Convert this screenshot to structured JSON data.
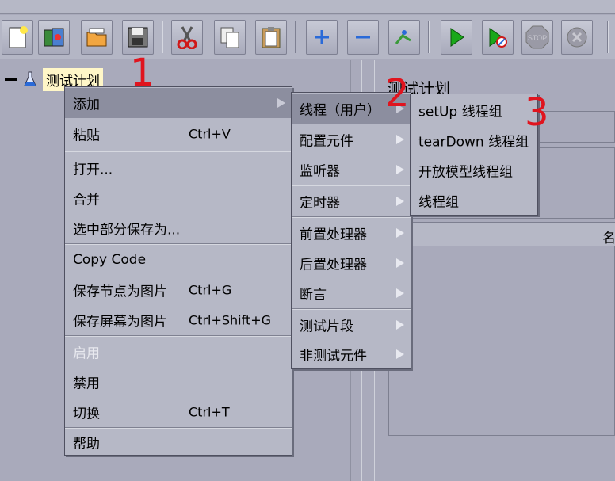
{
  "tree": {
    "root_label": "测试计划"
  },
  "right_pane": {
    "title": "测试计划",
    "column_header": "名"
  },
  "context_menu": {
    "items": [
      {
        "label": "添加",
        "shortcut": "",
        "submenu": true,
        "highlighted": true
      },
      {
        "label": "粘贴",
        "shortcut": "Ctrl+V"
      },
      {
        "label": "打开...",
        "shortcut": ""
      },
      {
        "label": "合并",
        "shortcut": ""
      },
      {
        "label": "选中部分保存为...",
        "shortcut": ""
      },
      {
        "label": "Copy Code",
        "shortcut": ""
      },
      {
        "label": "保存节点为图片",
        "shortcut": "Ctrl+G"
      },
      {
        "label": "保存屏幕为图片",
        "shortcut": "Ctrl+Shift+G"
      },
      {
        "label": "启用",
        "shortcut": "",
        "disabled": true
      },
      {
        "label": "禁用",
        "shortcut": ""
      },
      {
        "label": "切换",
        "shortcut": "Ctrl+T"
      },
      {
        "label": "帮助",
        "shortcut": ""
      }
    ]
  },
  "add_submenu": {
    "items": [
      {
        "label": "线程（用户）",
        "highlighted": true
      },
      {
        "label": "配置元件"
      },
      {
        "label": "监听器"
      },
      {
        "label": "定时器"
      },
      {
        "label": "前置处理器"
      },
      {
        "label": "后置处理器"
      },
      {
        "label": "断言"
      },
      {
        "label": "测试片段"
      },
      {
        "label": "非测试元件"
      }
    ]
  },
  "thread_submenu": {
    "items": [
      {
        "label": "setUp 线程组"
      },
      {
        "label": "tearDown 线程组"
      },
      {
        "label": "开放模型线程组"
      },
      {
        "label": "线程组"
      }
    ]
  },
  "annotations": {
    "a1": "1",
    "a2": "2",
    "a3": "3"
  },
  "colors": {
    "annotation": "#e0141e",
    "menu_bg": "#b6b8c6",
    "highlight": "#8c8e9f",
    "window_bg": "#a9aabb"
  },
  "toolbar_icons": [
    "new-icon",
    "templates-icon",
    "open-icon",
    "save-icon",
    "cut-icon",
    "copy-icon",
    "paste-icon",
    "expand-icon",
    "collapse-icon",
    "toggle-icon",
    "start-icon",
    "start-no-pause-icon",
    "stop-icon",
    "shutdown-icon"
  ]
}
